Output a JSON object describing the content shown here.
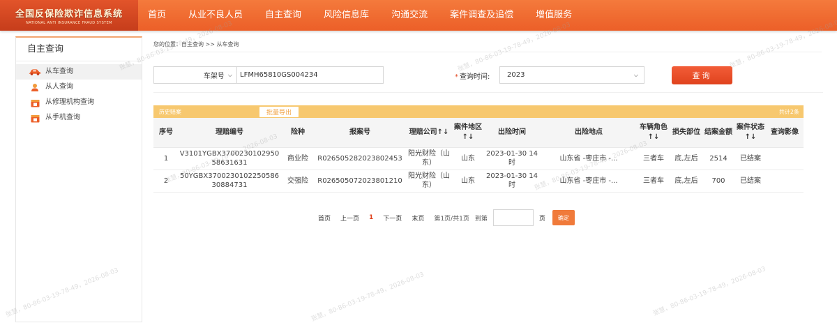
{
  "header": {
    "logo_cn": "全国反保险欺诈信息系统",
    "logo_en": "NATIONAL ANTI INSURANCE FRAUD SYSTEM",
    "nav": [
      "首页",
      "从业不良人员",
      "自主查询",
      "风险信息库",
      "沟通交流",
      "案件调查及追偿",
      "增值服务"
    ],
    "accent": "#ec5f28"
  },
  "sidebar": {
    "title": "自主查询",
    "items": [
      {
        "label": "从车查询",
        "icon": "car-icon",
        "active": true
      },
      {
        "label": "从人查询",
        "icon": "person-icon",
        "active": false
      },
      {
        "label": "从修理机构查询",
        "icon": "repair-shop-icon",
        "active": false
      },
      {
        "label": "从手机查询",
        "icon": "phone-icon",
        "active": false
      }
    ]
  },
  "breadcrumb": "您的位置：自主查询 >> 从车查询",
  "search": {
    "type_selected": "车架号",
    "vin_value": "LFMH65810GS004234",
    "time_label": "查询时间:",
    "time_selected": "2023",
    "button": "查询"
  },
  "table": {
    "history_label": "历史赔案",
    "export_label": "批量导出",
    "total_label": "共计2条",
    "columns": [
      "序号",
      "理赔编号",
      "险种",
      "报案号",
      "理赔公司↑↓",
      "案件地区↑↓",
      "出险时间",
      "出险地点",
      "车辆角色↑↓",
      "损失部位",
      "结案金额",
      "案件状态↑↓",
      "查询影像"
    ],
    "rows": [
      [
        "1",
        "V3101YGBX370023010295058631631",
        "商业险",
        "R026505282023802453",
        "阳光财险（山东）",
        "山东",
        "2023-01-30 14时",
        "山东省 -枣庄市 -...",
        "三者车",
        "底,左后",
        "2514",
        "已结案",
        ""
      ],
      [
        "2",
        "50YGBX370023010225058630884731",
        "交强险",
        "R026505072023801210",
        "阳光财险（山东）",
        "山东",
        "2023-01-30 14时",
        "山东省 -枣庄市 -...",
        "三者车",
        "底,左后",
        "700",
        "已结案",
        ""
      ]
    ]
  },
  "pagination": {
    "first": "首页",
    "prev": "上一页",
    "current": "1",
    "next": "下一页",
    "last": "末页",
    "info": "第1页/共1页",
    "goto": "到第",
    "unit": "页",
    "confirm": "确定"
  },
  "watermark": "张慧，80-86-03-19-78-49，2026-08-03"
}
